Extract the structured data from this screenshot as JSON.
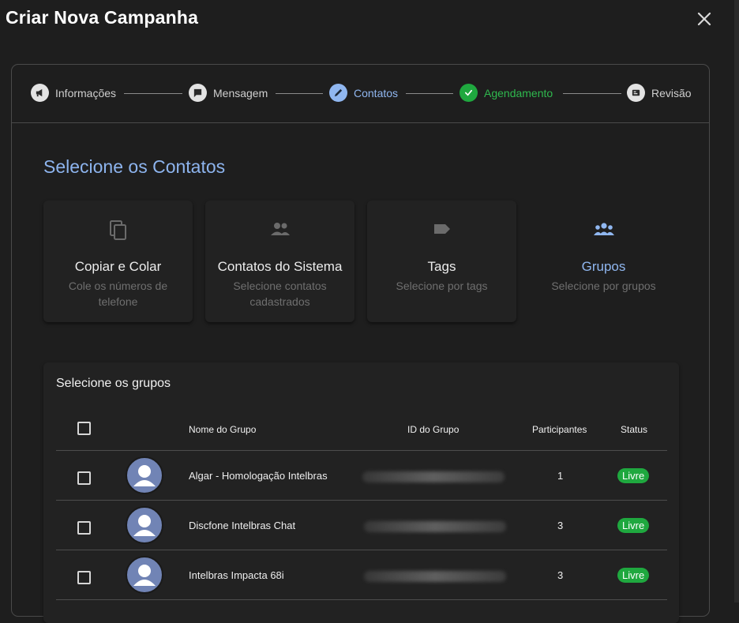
{
  "dialog": {
    "title": "Criar Nova Campanha",
    "close_icon": "close-icon"
  },
  "stepper": {
    "steps": [
      {
        "label": "Informações",
        "icon": "megaphone-icon",
        "state": "default"
      },
      {
        "label": "Mensagem",
        "icon": "chat-icon",
        "state": "default"
      },
      {
        "label": "Contatos",
        "icon": "pencil-icon",
        "state": "active"
      },
      {
        "label": "Agendamento",
        "icon": "check-icon",
        "state": "completed"
      },
      {
        "label": "Revisão",
        "icon": "review-icon",
        "state": "default"
      }
    ]
  },
  "contacts": {
    "title": "Selecione os Contatos",
    "options": [
      {
        "title": "Copiar e Colar",
        "subtitle": "Cole os números de telefone",
        "icon": "copy-icon"
      },
      {
        "title": "Contatos do Sistema",
        "subtitle": "Selecione contatos cadastrados",
        "icon": "people-icon"
      },
      {
        "title": "Tags",
        "subtitle": "Selecione por tags",
        "icon": "tag-icon"
      },
      {
        "title": "Grupos",
        "subtitle": "Selecione por grupos",
        "icon": "groups-icon",
        "selected": true
      }
    ]
  },
  "groups": {
    "title": "Selecione os grupos",
    "columns": {
      "name": "Nome do Grupo",
      "id": "ID do Grupo",
      "participants": "Participantes",
      "status": "Status"
    },
    "rows": [
      {
        "name": "Algar - Homologação Intelbras",
        "participants": "1",
        "status": "Livre"
      },
      {
        "name": "Discfone Intelbras Chat",
        "participants": "3",
        "status": "Livre"
      },
      {
        "name": "Intelbras Impacta 68i",
        "participants": "3",
        "status": "Livre"
      }
    ]
  },
  "colors": {
    "accent_blue": "#90b7f0",
    "success_green": "#1fa83f",
    "background": "#1e1e1e"
  }
}
